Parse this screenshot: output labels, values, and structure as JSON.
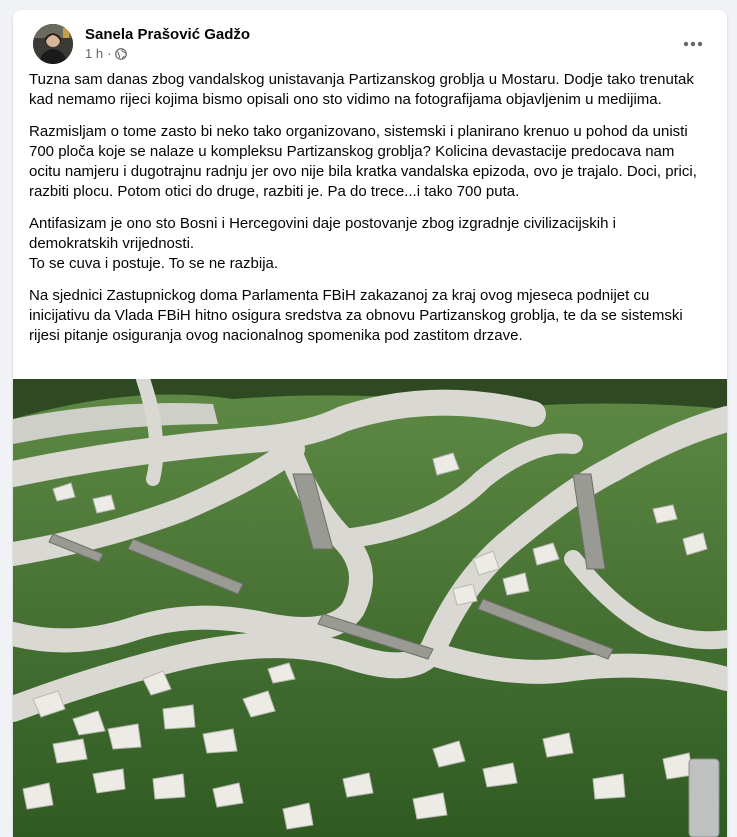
{
  "post": {
    "author": "Sanela Prašović Gadžo",
    "time": "1 h",
    "separator": "·",
    "privacy_icon": "globe-icon",
    "more_icon": "more-options-icon",
    "paragraphs": [
      "Tuzna sam danas zbog  vandalskog unistavanja Partizanskog groblja u Mostaru. Dodje tako trenutak kad nemamo rijeci kojima bismo opisali ono sto vidimo na fotografijama objavljenim u medijima.",
      "Razmisljam o tome zasto bi neko tako organizovano, sistemski i planirano krenuo u pohod da unisti 700 ploča koje se nalaze u kompleksu Partizanskog groblja? Kolicina devastacije predocava nam ocitu namjeru i dugotrajnu radnju jer ovo nije bila kratka vandalska epizoda, ovo je trajalo. Doci, prici, razbiti plocu. Potom otici do druge, razbiti je. Pa do trece...i tako 700 puta.",
      "Antifasizam je ono sto Bosni i Hercegovini daje postovanje zbog izgradnje civilizacijskih i demokratskih vrijednosti.\nTo se cuva i postuje. To se ne razbija.",
      "Na sjednici Zastupnickog doma Parlamenta FBiH zakazanoj za kraj ovog mjeseca podnijet cu inicijativu da Vlada FBiH hitno osigura sredstva za obnovu Partizanskog groblja, te da se sistemski rijesi pitanje osiguranja ovog nacionalnog spomenika pod zastitom drzave."
    ]
  },
  "colors": {
    "background": "#f0f2f5",
    "card": "#ffffff",
    "text": "#050505",
    "secondary": "#65676b",
    "grass": "#3d6b2c",
    "stone": "#d8d8d4"
  }
}
